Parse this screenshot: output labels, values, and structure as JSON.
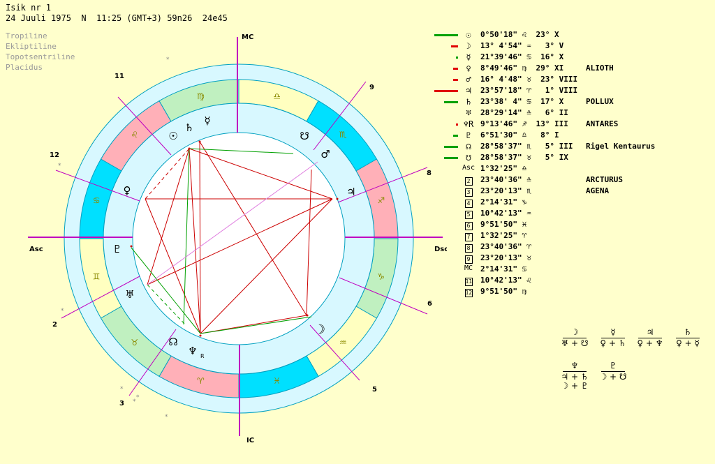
{
  "header": {
    "title": "Isik nr 1",
    "info": "24 Juuli 1975  N  11:25 (GMT+3) 59n26  24e45"
  },
  "system": [
    "Tropiline",
    "Ekliptiline",
    "Topotsentriline",
    "Placidus"
  ],
  "axes": {
    "mc": "MC",
    "ic": "IC",
    "asc": "Asc",
    "dsc": "Dsc"
  },
  "houses": [
    {
      "label": "2"
    },
    {
      "label": "3"
    },
    {
      "label": "5"
    },
    {
      "label": "6"
    },
    {
      "label": "8"
    },
    {
      "label": "9"
    },
    {
      "label": "11"
    },
    {
      "label": "12"
    }
  ],
  "zodiac_ring": [
    {
      "sign": "♊",
      "color": "#ffffc0"
    },
    {
      "sign": "♋",
      "color": "#00e0ff"
    },
    {
      "sign": "♌",
      "color": "#ffb0b8"
    },
    {
      "sign": "♍",
      "color": "#c0f0c0"
    },
    {
      "sign": "♎",
      "color": "#ffffc0"
    },
    {
      "sign": "♏",
      "color": "#00e0ff"
    },
    {
      "sign": "♐",
      "color": "#ffb0b8"
    },
    {
      "sign": "♑",
      "color": "#c0f0c0"
    },
    {
      "sign": "♒",
      "color": "#ffffc0"
    },
    {
      "sign": "♓",
      "color": "#00e0ff"
    },
    {
      "sign": "♈",
      "color": "#ffb0b8"
    },
    {
      "sign": "♉",
      "color": "#c0f0c0"
    }
  ],
  "chart_planets": [
    {
      "glyph": "☉"
    },
    {
      "glyph": "♄"
    },
    {
      "glyph": "☿"
    },
    {
      "glyph": "☋"
    },
    {
      "glyph": "♂"
    },
    {
      "glyph": "♃"
    },
    {
      "glyph": "♀"
    },
    {
      "glyph": "♆"
    },
    {
      "glyph": "♅"
    },
    {
      "glyph": "☊"
    },
    {
      "glyph": "♇"
    },
    {
      "glyph": "☽"
    }
  ],
  "chart_small_labels": [
    "R"
  ],
  "positions": [
    {
      "glyph": "☉",
      "value": "0°50'18\" ♌  23° X",
      "star": "",
      "bar_color": "#00a000"
    },
    {
      "glyph": "☽",
      "value": "13° 4'54\" ♒   3° V",
      "star": "",
      "bar_color": "#e00000"
    },
    {
      "glyph": "☿",
      "value": "21°39'46\" ♋  16° X",
      "star": "",
      "bar_color": "#00a000"
    },
    {
      "glyph": "♀",
      "value": "8°49'46\" ♍  29° XI",
      "star": "ALIOTH",
      "bar_color": "#e00000"
    },
    {
      "glyph": "♂",
      "value": "16° 4'48\" ♉  23° VIII",
      "star": "",
      "bar_color": "#e00000"
    },
    {
      "glyph": "♃",
      "value": "23°57'18\" ♈   1° VIII",
      "star": "",
      "bar_color": "#e00000"
    },
    {
      "glyph": "♄",
      "value": "23°38' 4\" ♋  17° X",
      "star": "POLLUX",
      "bar_color": "#00a000"
    },
    {
      "glyph": "♅",
      "value": "28°29'14\" ♎   6° II",
      "star": "",
      "bar_color": ""
    },
    {
      "glyph": "♆R",
      "value": "9°13'46\" ♐  13° III",
      "star": "ANTARES",
      "bar_color": "#e00000"
    },
    {
      "glyph": "♇",
      "value": "6°51'30\" ♎   8° I",
      "star": "",
      "bar_color": "#00a000"
    },
    {
      "glyph": "☊",
      "value": "28°58'37\" ♏   5° III",
      "star": "Rigel Kentaurus",
      "bar_color": "#00a000"
    },
    {
      "glyph": "☋",
      "value": "28°58'37\" ♉   5° IX",
      "star": "",
      "bar_color": "#00a000"
    },
    {
      "glyph": "Asc",
      "value": "1°32'25\" ♎",
      "star": "",
      "bar_color": ""
    },
    {
      "glyph": "2",
      "value": "23°40'36\" ♎",
      "star": "ARCTURUS",
      "bar_color": ""
    },
    {
      "glyph": "3",
      "value": "23°20'13\" ♏",
      "star": "AGENA",
      "bar_color": ""
    },
    {
      "glyph": "4",
      "value": "2°14'31\" ♑",
      "star": "",
      "bar_color": ""
    },
    {
      "glyph": "5",
      "value": "10°42'13\" ♒",
      "star": "",
      "bar_color": ""
    },
    {
      "glyph": "6",
      "value": "9°51'50\" ♓",
      "star": "",
      "bar_color": ""
    },
    {
      "glyph": "7",
      "value": "1°32'25\" ♈",
      "star": "",
      "bar_color": ""
    },
    {
      "glyph": "8",
      "value": "23°40'36\" ♈",
      "star": "",
      "bar_color": ""
    },
    {
      "glyph": "9",
      "value": "23°20'13\" ♉",
      "star": "",
      "bar_color": ""
    },
    {
      "glyph": "MC",
      "value": "2°14'31\" ♋",
      "star": "",
      "bar_color": ""
    },
    {
      "glyph": "11",
      "value": "10°42'13\" ♌",
      "star": "",
      "bar_color": ""
    },
    {
      "glyph": "12",
      "value": "9°51'50\" ♍",
      "star": "",
      "bar_color": ""
    }
  ],
  "bar_strength": [
    1.0,
    0.3,
    0.05,
    0.2,
    0.2,
    1.0,
    0.6,
    0,
    0.1,
    0.2,
    0.6,
    0.6
  ],
  "configurations": [
    {
      "top": "☽",
      "bottom": "♅ + ☋"
    },
    {
      "top": "☿",
      "bottom": "♀ + ♄"
    },
    {
      "top": "♃",
      "bottom": "♀ + ♆"
    },
    {
      "top": "♄",
      "bottom": "♀ + ☿"
    },
    {
      "top": "♆",
      "bottom": "♃ + ♄",
      "extra": "☽ + ♇"
    },
    {
      "top": "♇",
      "bottom": "☽ + ☋"
    }
  ]
}
